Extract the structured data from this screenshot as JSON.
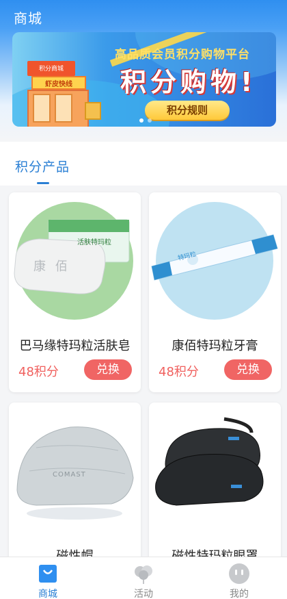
{
  "header": {
    "title": "商城"
  },
  "banner": {
    "store_roof": "积分商城",
    "store_sign": "虾皮快线",
    "subtitle": "高品质会员积分购物平台",
    "headline": "积分购物!",
    "rules_button": "积分规则"
  },
  "section": {
    "title": "积分产品"
  },
  "products": [
    {
      "name": "巴马缘特玛粒活肤皂",
      "price": "48积分",
      "button": "兑换",
      "pkg_text": "活肤特玛粒",
      "bar_text": "康 佰"
    },
    {
      "name": "康佰特玛粒牙膏",
      "price": "48积分",
      "button": "兑换",
      "pkg_text": "特玛粒"
    },
    {
      "name": "磁性帽",
      "price": "",
      "button": "",
      "emboss": "COMAST"
    },
    {
      "name": "磁性特玛粒眼罩",
      "price": "",
      "button": ""
    }
  ],
  "tabbar": {
    "items": [
      {
        "label": "商城",
        "icon": "bag-icon",
        "active": true
      },
      {
        "label": "活动",
        "icon": "balloons-icon",
        "active": false
      },
      {
        "label": "我的",
        "icon": "face-icon",
        "active": false
      }
    ]
  },
  "colors": {
    "primary": "#2a7fd4",
    "accent": "#f06564",
    "price": "#f0605e"
  }
}
